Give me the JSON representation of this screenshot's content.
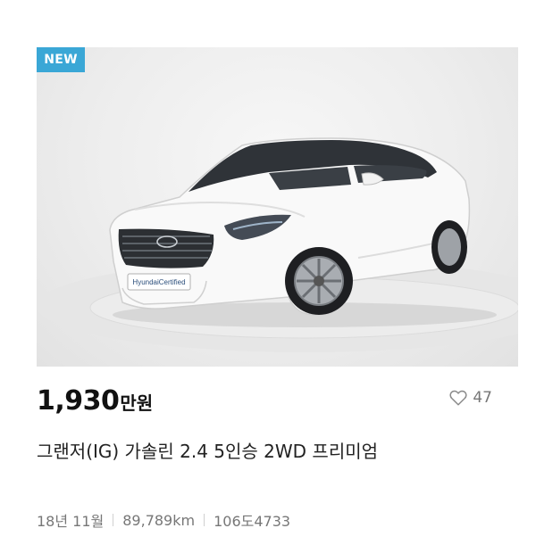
{
  "listing": {
    "badge": "NEW",
    "price_value": "1,930",
    "price_unit": "만원",
    "likes": "47",
    "title": "그랜저(IG) 가솔린 2.4 5인승 2WD 프리미엄",
    "meta": {
      "registration": "18년 11월",
      "mileage": "89,789km",
      "plate": "106도4733"
    },
    "photo": {
      "plate_text": "HyundaiCertified"
    }
  },
  "icons": {
    "like": "heart-outline-icon"
  },
  "colors": {
    "badge_bg": "#3aa7d6",
    "price": "#111111",
    "meta_text": "#777777"
  }
}
